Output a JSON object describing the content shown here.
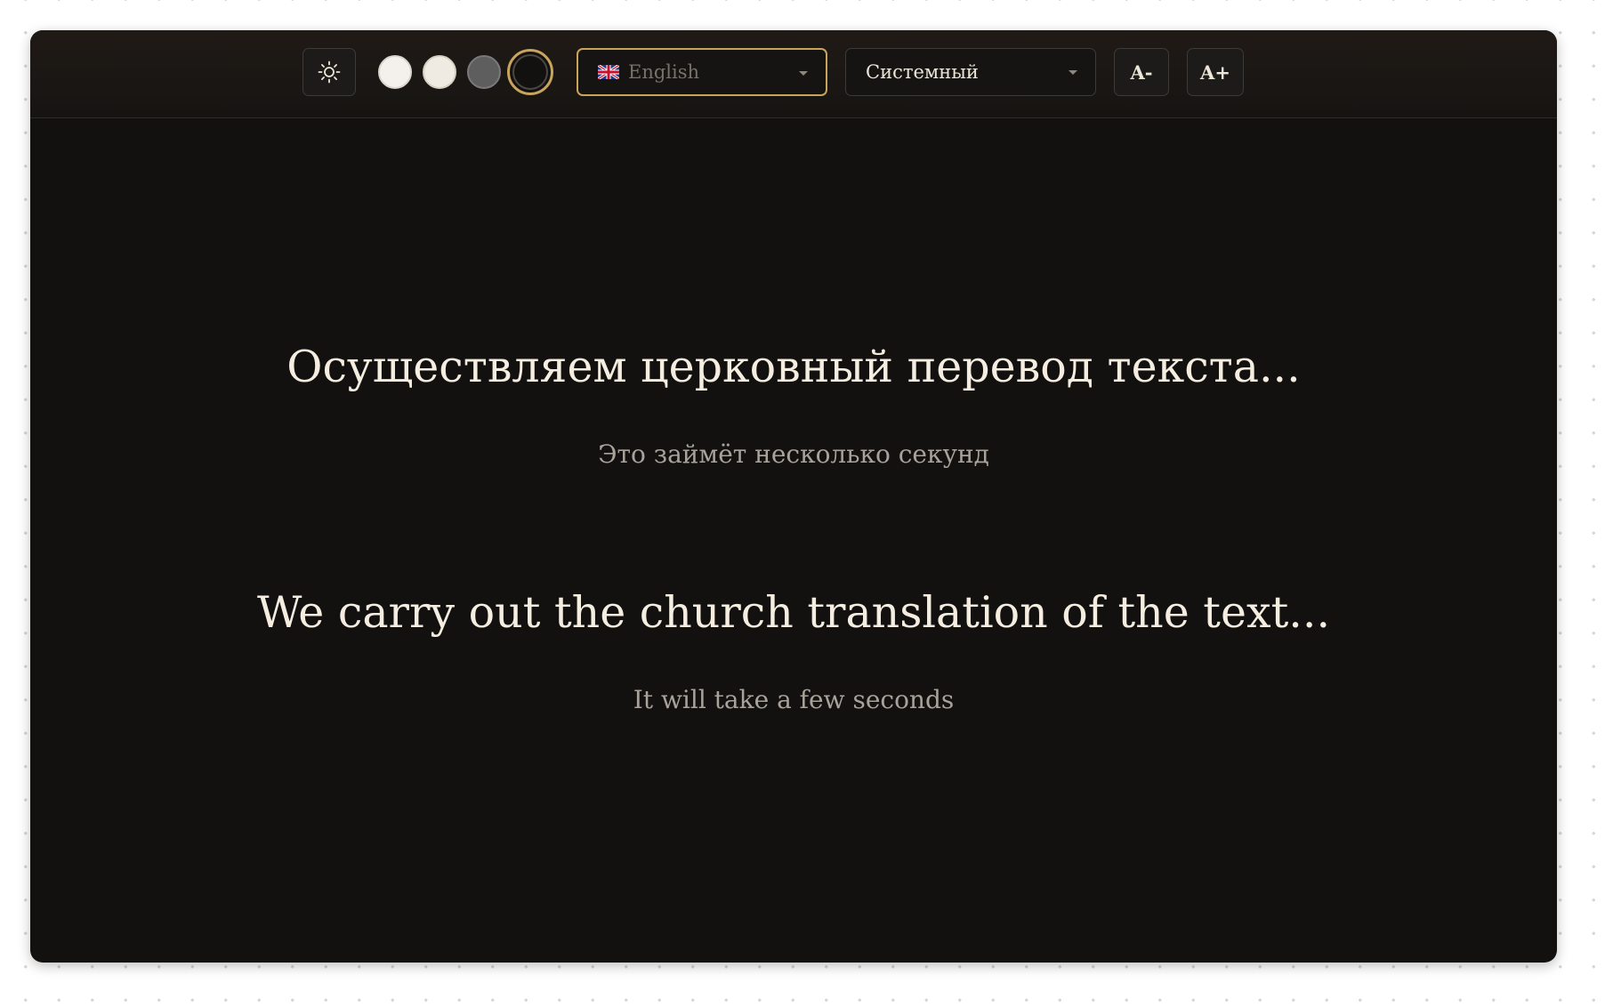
{
  "toolbar": {
    "theme_icon": "sun-icon",
    "swatches": [
      {
        "name": "light",
        "color": "#f4f1ec"
      },
      {
        "name": "sepia",
        "color": "#f0ebe2"
      },
      {
        "name": "gray",
        "color": "#5e5e5e"
      },
      {
        "name": "dark",
        "color": "#121110",
        "selected": true
      }
    ],
    "language_select": {
      "flag_icon": "uk-flag-icon",
      "value": "English"
    },
    "font_select": {
      "value": "Системный"
    },
    "font_decrease_label": "A-",
    "font_increase_label": "A+"
  },
  "loading": {
    "ru": {
      "title": "Осуществляем церковный перевод текста...",
      "subtitle": "Это займёт несколько секунд"
    },
    "en": {
      "title": "We carry out the church translation of the text...",
      "subtitle": "It will take a few seconds"
    }
  },
  "colors": {
    "background": "#121110",
    "accent": "#c9a45c",
    "text_primary": "#f4ede0",
    "text_secondary": "#a8a29a"
  }
}
